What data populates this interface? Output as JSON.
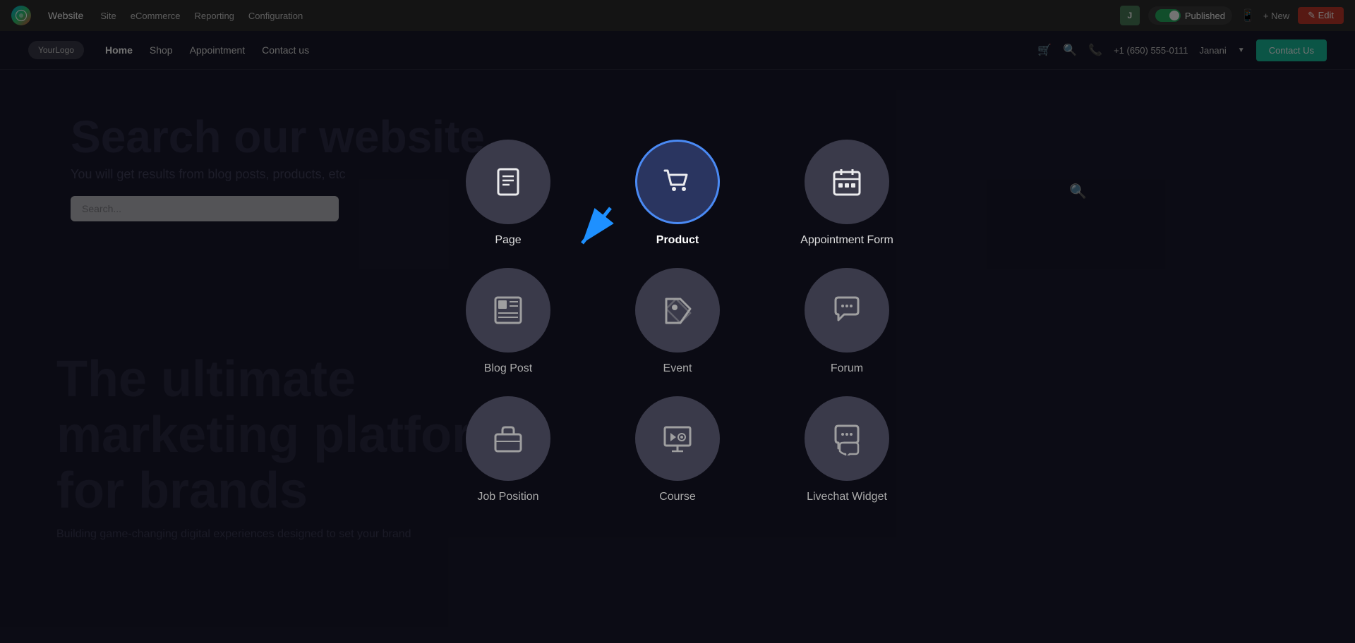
{
  "topbar": {
    "brand": "Website",
    "nav_items": [
      "Site",
      "eCommerce",
      "Reporting",
      "Configuration"
    ],
    "user_initial": "J",
    "published_label": "Published",
    "new_label": "+ New",
    "edit_label": "✎ Edit",
    "toggle_on": true
  },
  "site_nav": {
    "logo": "YourLogo",
    "links": [
      "Home",
      "Shop",
      "Appointment",
      "Contact us"
    ],
    "phone": "+1 (650) 555-0111",
    "user": "Janani",
    "contact_btn": "Contact Us"
  },
  "hero": {
    "title": "Search our website",
    "subtitle": "You will get results from blog posts, products, etc",
    "search_placeholder": "Search...",
    "bottom_title": "The ultimate\nmarketing platform\nfor brands",
    "bottom_subtitle": "Building game-changing digital experiences designed to set your brand"
  },
  "modal": {
    "items": [
      {
        "id": "page",
        "label": "Page",
        "icon": "page",
        "selected": false
      },
      {
        "id": "product",
        "label": "Product",
        "icon": "cart",
        "selected": true
      },
      {
        "id": "appointment-form",
        "label": "Appointment Form",
        "icon": "calendar",
        "selected": false
      },
      {
        "id": "blog-post",
        "label": "Blog Post",
        "icon": "blog",
        "selected": false
      },
      {
        "id": "event",
        "label": "Event",
        "icon": "tag",
        "selected": false
      },
      {
        "id": "forum",
        "label": "Forum",
        "icon": "chat",
        "selected": false
      },
      {
        "id": "job-position",
        "label": "Job Position",
        "icon": "briefcase",
        "selected": false
      },
      {
        "id": "course",
        "label": "Course",
        "icon": "presentation",
        "selected": false
      },
      {
        "id": "livechat-widget",
        "label": "Livechat Widget",
        "icon": "livechat",
        "selected": false
      }
    ]
  },
  "colors": {
    "selected_bg": "#2a3560",
    "selected_border": "#4a8af4",
    "default_bg": "#3a3a4a",
    "arrow_color": "#1e90ff"
  }
}
